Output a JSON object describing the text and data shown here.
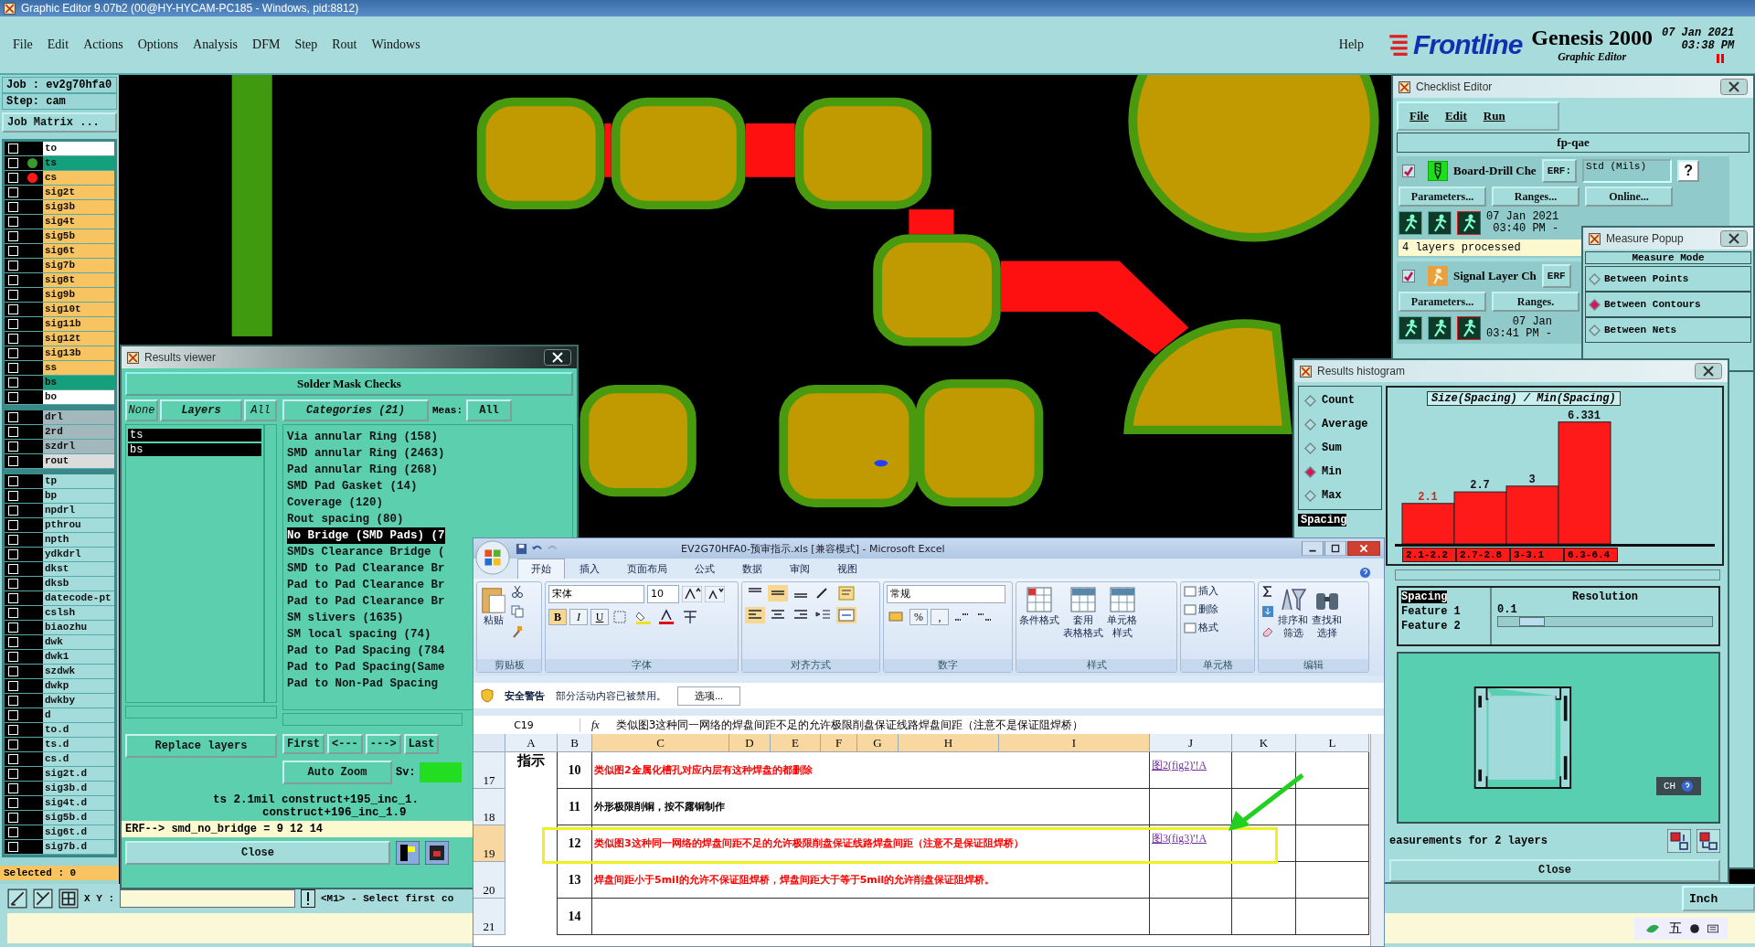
{
  "app": {
    "title": "Graphic Editor 9.07b2 (00@HY-HYCAM-PC185 - Windows, pid:8812)",
    "menus": [
      "File",
      "Edit",
      "Actions",
      "Options",
      "Analysis",
      "DFM",
      "Step",
      "Rout",
      "Windows"
    ],
    "help": "Help",
    "brand": {
      "logo": "Frontline",
      "product": "Genesis 2000",
      "subtitle": "Graphic Editor",
      "date": "07 Jan 2021",
      "time": "03:38 PM"
    }
  },
  "job_panel": {
    "job": "Job : ev2g70hfa0",
    "step": "Step: cam",
    "matrix_button": "Job Matrix ...",
    "layer_groups": [
      [
        {
          "name": "to",
          "color": "#ffffff",
          "checked": false
        },
        {
          "name": "ts",
          "color": "#14a07c",
          "checked": false,
          "dot": {
            "color": "#3a9a2a"
          }
        },
        {
          "name": "cs",
          "color": "#f8c462",
          "checked": false,
          "dot": {
            "color": "#ff1a1a"
          }
        },
        {
          "name": "sig2t",
          "color": "#f8c462",
          "checked": false
        },
        {
          "name": "sig3b",
          "color": "#f8c462",
          "checked": false
        },
        {
          "name": "sig4t",
          "color": "#f8c462",
          "checked": false
        },
        {
          "name": "sig5b",
          "color": "#f8c462",
          "checked": false
        },
        {
          "name": "sig6t",
          "color": "#f8c462",
          "checked": false
        },
        {
          "name": "sig7b",
          "color": "#f8c462",
          "checked": false
        },
        {
          "name": "sig8t",
          "color": "#f8c462",
          "checked": false
        },
        {
          "name": "sig9b",
          "color": "#f8c462",
          "checked": false
        },
        {
          "name": "sig10t",
          "color": "#f8c462",
          "checked": false
        },
        {
          "name": "sig11b",
          "color": "#f8c462",
          "checked": false
        },
        {
          "name": "sig12t",
          "color": "#f8c462",
          "checked": false
        },
        {
          "name": "sig13b",
          "color": "#f8c462",
          "checked": false
        },
        {
          "name": "ss",
          "color": "#f8c462",
          "checked": false
        },
        {
          "name": "bs",
          "color": "#14a07c",
          "checked": false
        },
        {
          "name": "bo",
          "color": "#ffffff",
          "checked": false
        }
      ],
      [
        {
          "name": "drl",
          "color": "#a3b8bc",
          "checked": false
        },
        {
          "name": "2rd",
          "color": "#a3b8bc",
          "checked": false
        },
        {
          "name": "szdrl",
          "color": "#a3b8bc",
          "checked": false
        },
        {
          "name": "rout",
          "color": "#dcdcdc",
          "checked": false
        }
      ],
      [
        {
          "name": "tp",
          "color": "#a4dcdc",
          "checked": false
        },
        {
          "name": "bp",
          "color": "#a4dcdc",
          "checked": false
        },
        {
          "name": "npdrl",
          "color": "#a4dcdc",
          "checked": false
        },
        {
          "name": "pthrou",
          "color": "#a4dcdc",
          "checked": false
        },
        {
          "name": "npth",
          "color": "#a4dcdc",
          "checked": false
        },
        {
          "name": "ydkdrl",
          "color": "#a4dcdc",
          "checked": false
        },
        {
          "name": "dkst",
          "color": "#a4dcdc",
          "checked": false
        },
        {
          "name": "dksb",
          "color": "#a4dcdc",
          "checked": false
        },
        {
          "name": "datecode-pt",
          "color": "#a4dcdc",
          "checked": false
        },
        {
          "name": "cslsh",
          "color": "#a4dcdc",
          "checked": false
        },
        {
          "name": "biaozhu",
          "color": "#a4dcdc",
          "checked": false
        },
        {
          "name": "dwk",
          "color": "#a4dcdc",
          "checked": false
        },
        {
          "name": "dwk1",
          "color": "#a4dcdc",
          "checked": false
        },
        {
          "name": "szdwk",
          "color": "#a4dcdc",
          "checked": false
        },
        {
          "name": "dwkp",
          "color": "#a4dcdc",
          "checked": false
        },
        {
          "name": "dwkby",
          "color": "#a4dcdc",
          "checked": false
        },
        {
          "name": "d",
          "color": "#a4dcdc",
          "checked": false
        },
        {
          "name": "to.d",
          "color": "#a4dcdc",
          "checked": false
        },
        {
          "name": "ts.d",
          "color": "#a4dcdc",
          "checked": false
        },
        {
          "name": "cs.d",
          "color": "#a4dcdc",
          "checked": false
        },
        {
          "name": "sig2t.d",
          "color": "#a4dcdc",
          "checked": false
        },
        {
          "name": "sig3b.d",
          "color": "#a4dcdc",
          "checked": false
        },
        {
          "name": "sig4t.d",
          "color": "#a4dcdc",
          "checked": false
        },
        {
          "name": "sig5b.d",
          "color": "#a4dcdc",
          "checked": false
        },
        {
          "name": "sig6t.d",
          "color": "#a4dcdc",
          "checked": false
        },
        {
          "name": "sig7b.d",
          "color": "#a4dcdc",
          "checked": false
        }
      ]
    ],
    "selected": "Selected : 0"
  },
  "results_viewer": {
    "title": "Results viewer",
    "heading": "Solder Mask Checks",
    "layer_buttons": [
      "None",
      "Layers",
      "All"
    ],
    "layers": [
      {
        "name": "ts",
        "selected": true
      },
      {
        "name": "bs",
        "selected": true
      }
    ],
    "categories_button": "Categories (21)",
    "meas_label": "Meas:",
    "meas_value": "All",
    "categories": [
      {
        "label": "Via annular Ring (158)",
        "selected": false
      },
      {
        "label": "SMD annular Ring (2463)",
        "selected": false
      },
      {
        "label": "Pad annular Ring (268)",
        "selected": false
      },
      {
        "label": "SMD Pad Gasket (14)",
        "selected": false
      },
      {
        "label": "Coverage (120)",
        "selected": false
      },
      {
        "label": "Rout spacing (80)",
        "selected": false
      },
      {
        "label": "No Bridge (SMD Pads) (7",
        "selected": true
      },
      {
        "label": "SMDs Clearance Bridge (",
        "selected": false
      },
      {
        "label": "SMD to Pad Clearance Br",
        "selected": false
      },
      {
        "label": "Pad to Pad Clearance Br",
        "selected": false
      },
      {
        "label": "Pad to Pad Clearance Br",
        "selected": false
      },
      {
        "label": "SM slivers (1635)",
        "selected": false
      },
      {
        "label": "SM local spacing (74)",
        "selected": false
      },
      {
        "label": "Pad to Pad Spacing (784",
        "selected": false
      },
      {
        "label": "Pad to Pad Spacing(Same",
        "selected": false
      },
      {
        "label": "Pad to Non-Pad Spacing",
        "selected": false
      }
    ],
    "nav": [
      "First",
      "<---",
      "--->",
      "Last"
    ],
    "zoom": "Auto Zoom",
    "sv_label": "Sv:",
    "replace": "Replace layers",
    "info_lines": [
      "ts 2.1mil  construct+195_inc_1.",
      "construct+196_inc_1.9"
    ],
    "erf": "ERF--> smd_no_bridge = 9 12 14",
    "close": "Close"
  },
  "checklist": {
    "title": "Checklist Editor",
    "menus": [
      "File",
      "Edit",
      "Run"
    ],
    "name": "fp-qae",
    "checks": [
      {
        "kind": "drill",
        "enabled": true,
        "label": "Board-Drill Che",
        "erf": "ERF:",
        "erf_value": "Std (Mils)",
        "help": "?",
        "buttons": [
          "Parameters...",
          "Ranges...",
          "Online..."
        ],
        "date": "07 Jan 2021",
        "time": "03:40 PM -",
        "status": "4 layers processed"
      },
      {
        "kind": "signal",
        "enabled": true,
        "label": "Signal Layer Ch",
        "erf": "ERF",
        "buttons": [
          "Parameters...",
          "Ranges."
        ],
        "date": "07 Jan",
        "time": "03:41 PM -"
      }
    ]
  },
  "measure_popup": {
    "title": "Measure Popup",
    "heading": "Measure Mode",
    "modes": [
      {
        "label": "Between Points",
        "selected": false
      },
      {
        "label": "Between Contours",
        "selected": true
      },
      {
        "label": "Between Nets",
        "selected": false
      }
    ]
  },
  "histogram": {
    "title": "Results histogram",
    "functions": [
      {
        "label": "Count",
        "selected": false
      },
      {
        "label": "Average",
        "selected": false
      },
      {
        "label": "Sum",
        "selected": false
      },
      {
        "label": "Min",
        "selected": true
      },
      {
        "label": "Max",
        "selected": false
      }
    ],
    "attributes": [
      {
        "label": "Spacing",
        "selected": true
      }
    ],
    "chart_data": {
      "type": "bar",
      "title": "Size(Spacing) / Min(Spacing)",
      "categories": [
        "2.1-2.2",
        "2.7-2.8",
        "3-3.1",
        "6.3-6.4"
      ],
      "values": [
        2.1,
        2.7,
        3,
        6.331
      ],
      "value_labels": [
        "2.1",
        "2.7",
        "3",
        "6.331"
      ]
    },
    "fields": [
      {
        "label": "Spacing",
        "selected": true
      },
      {
        "label": "Feature 1",
        "selected": false
      },
      {
        "label": "Feature 2",
        "selected": false
      }
    ],
    "resolution_label": "Resolution",
    "resolution_value": "0.1",
    "resolution_slider": {
      "level": 0.1
    },
    "status": "easurements for 2 layers",
    "close": "Close"
  },
  "excel": {
    "title": "EV2G70HFA0-预审指示.xls  [兼容模式] - Microsoft Excel",
    "tabs": [
      {
        "label": "开始",
        "selected": true
      },
      {
        "label": "插入",
        "selected": false
      },
      {
        "label": "页面布局",
        "selected": false
      },
      {
        "label": "公式",
        "selected": false
      },
      {
        "label": "数据",
        "selected": false
      },
      {
        "label": "审阅",
        "selected": false
      },
      {
        "label": "视图",
        "selected": false
      }
    ],
    "paste": "粘贴",
    "font_name": "宋体",
    "font_size": "10",
    "bold": "B",
    "italic": "I",
    "underline": "U",
    "number_format": "常规",
    "percent": "%",
    "comma": ",",
    "styles": [
      [
        "条件格式"
      ],
      [
        "套用",
        "表格格式"
      ],
      [
        "单元格",
        "样式"
      ]
    ],
    "cells": [
      "插入",
      "删除",
      "格式"
    ],
    "editing": [
      [
        "排序和",
        "筛选"
      ],
      [
        "查找和",
        "选择"
      ]
    ],
    "groups": [
      "剪贴板",
      "字体",
      "对齐方式",
      "数字",
      "样式",
      "单元格",
      "编辑"
    ],
    "security": {
      "title": "安全警告",
      "message": "部分活动内容已被禁用。",
      "button": "选项..."
    },
    "formula": {
      "cell": "C19",
      "fx": "fx",
      "value": "类似图3这种同一网络的焊盘间距不足的允许极限削盘保证线路焊盘间距（注意不是保证阻焊桥）"
    },
    "columns": [
      {
        "label": "A",
        "selected": false
      },
      {
        "label": "B",
        "selected": false
      },
      {
        "label": "C",
        "selected": true
      },
      {
        "label": "D",
        "selected": true
      },
      {
        "label": "E",
        "selected": true
      },
      {
        "label": "F",
        "selected": true
      },
      {
        "label": "G",
        "selected": true
      },
      {
        "label": "H",
        "selected": true
      },
      {
        "label": "I",
        "selected": true
      },
      {
        "label": "J",
        "selected": false
      },
      {
        "label": "K",
        "selected": false
      },
      {
        "label": "L",
        "selected": false
      }
    ],
    "rows": [
      {
        "number": "17",
        "selected": false,
        "label": "指示",
        "index": "10",
        "text": "类似图2金属化槽孔对应内层有这种焊盘的都删除",
        "color": "#ff0000",
        "link": "图2(fig2)'!A"
      },
      {
        "number": "18",
        "selected": false,
        "index": "11",
        "text": "外形极限削铜，按不露铜制作",
        "color": "#000000"
      },
      {
        "number": "19",
        "selected": true,
        "index": "12",
        "text": "类似图3这种同一网络的焊盘间距不足的允许极限削盘保证线路焊盘间距（注意不是保证阻焊桥）",
        "color": "#ff0000",
        "link": "图3(fig3)'!A"
      },
      {
        "number": "20",
        "selected": false,
        "index": "13",
        "text": "焊盘间距小于5mil的允许不保证阻焊桥，焊盘间距大于等于5mil的允许削盘保证阻焊桥。",
        "color": "#ff0000"
      },
      {
        "number": "21",
        "selected": false,
        "index": "14"
      }
    ]
  },
  "status_bar": {
    "xy_label": "X Y :",
    "message": "<M1> - Select first co",
    "units": "Inch",
    "ime_language": "CH",
    "ime_mode": "五"
  }
}
